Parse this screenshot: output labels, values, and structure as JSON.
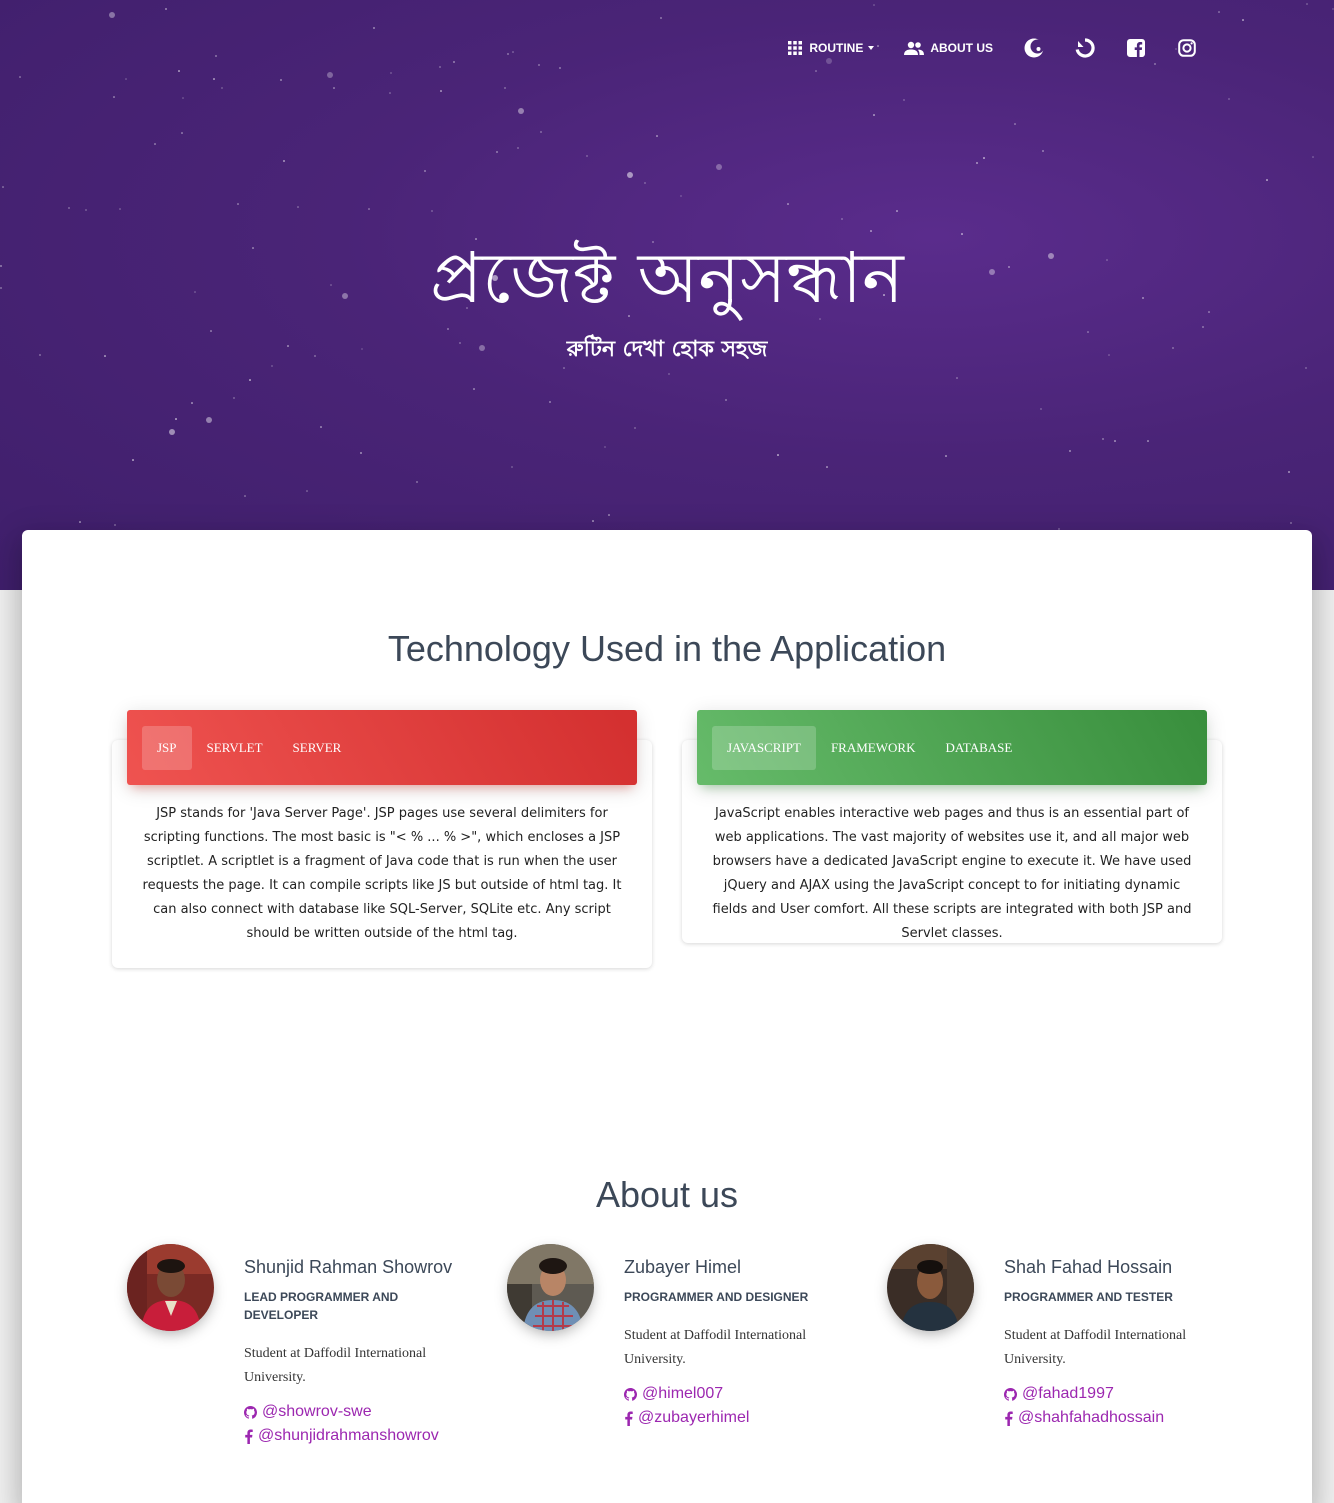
{
  "nav": {
    "routine_label": "ROUTINE",
    "about_label": "ABOUT US",
    "icons": [
      "crescent-icon",
      "refresh-icon",
      "facebook-icon",
      "instagram-icon"
    ]
  },
  "hero": {
    "title": "প্রজেক্ট অনুসন্ধান",
    "subtitle": "রুটিন দেখা হোক সহজ"
  },
  "technology": {
    "title": "Technology Used in the Application",
    "card_left": {
      "tabs": [
        "JSP",
        "SERVLET",
        "SERVER"
      ],
      "active_tab": "JSP",
      "text": "JSP stands for 'Java Server Page'. JSP pages use several delimiters for scripting functions. The most basic is \"< % ... % >\", which encloses a JSP scriptlet. A scriptlet is a fragment of Java code that is run when the user requests the page. It can compile scripts like JS but outside of html tag. It can also connect with database like SQL-Server, SQLite etc. Any script should be written outside of the html tag."
    },
    "card_right": {
      "tabs": [
        "JAVASCRIPT",
        "FRAMEWORK",
        "DATABASE"
      ],
      "active_tab": "JAVASCRIPT",
      "text": "JavaScript enables interactive web pages and thus is an essential part of web applications. The vast majority of websites use it, and all major web browsers have a dedicated JavaScript engine to execute it. We have used jQuery and AJAX using the JavaScript concept to for initiating dynamic fields and User comfort. All these scripts are integrated with both JSP and Servlet classes."
    }
  },
  "about": {
    "title": "About us",
    "members": [
      {
        "name": "Shunjid Rahman Showrov",
        "role": "LEAD PROGRAMMER AND DEVELOPER",
        "description": "Student at Daffodil International University.",
        "github": "@showrov-swe",
        "facebook": "@shunjidrahmanshowrov"
      },
      {
        "name": "Zubayer Himel",
        "role": "PROGRAMMER AND DESIGNER",
        "description": "Student at Daffodil International University.",
        "github": "@himel007",
        "facebook": "@zubayerhimel"
      },
      {
        "name": "Shah Fahad Hossain",
        "role": "PROGRAMMER AND TESTER",
        "description": "Student at Daffodil International University.",
        "github": "@fahad1997",
        "facebook": "@shahfahadhossain"
      }
    ]
  },
  "colors": {
    "hero_bg": "#4a2477",
    "red_header": "#e53935",
    "green_header": "#43a047",
    "link": "#9c27b0",
    "heading": "#3c4858"
  }
}
